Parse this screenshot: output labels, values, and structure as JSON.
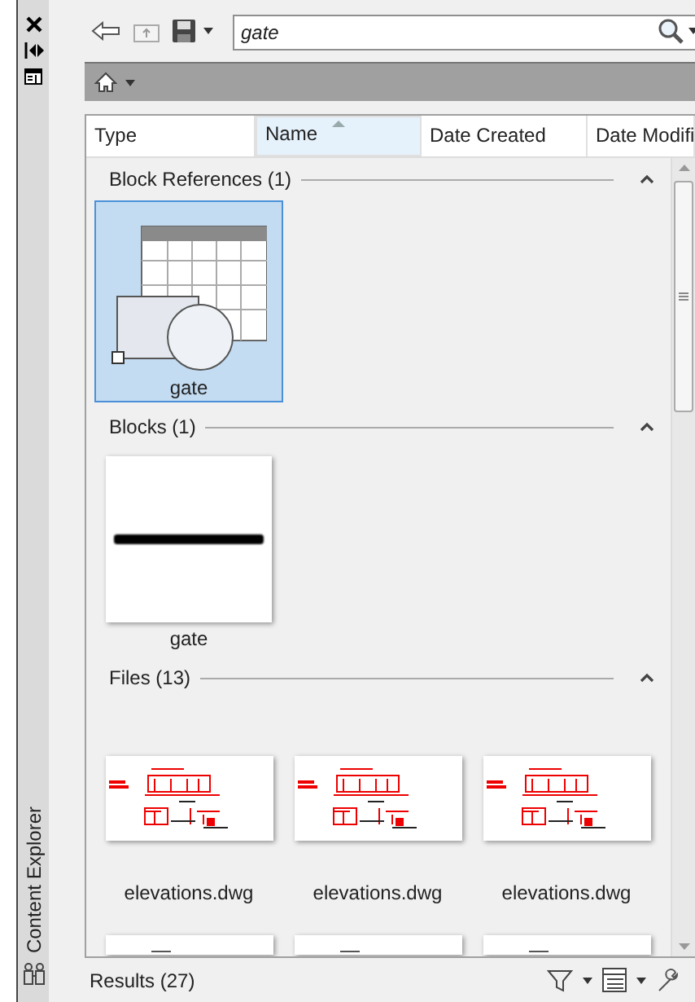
{
  "side_title": "Content Explorer",
  "search": {
    "value": "gate"
  },
  "columns": [
    {
      "label": "Type",
      "selected": false
    },
    {
      "label": "Name",
      "selected": true
    },
    {
      "label": "Date Created",
      "selected": false
    },
    {
      "label": "Date Modifi",
      "selected": false
    }
  ],
  "groups": [
    {
      "title": "Block References (1)",
      "expanded": true,
      "items": [
        {
          "kind": "block-reference",
          "name": "gate",
          "selected": true
        }
      ]
    },
    {
      "title": "Blocks (1)",
      "expanded": true,
      "items": [
        {
          "kind": "block",
          "name": "gate",
          "selected": false
        }
      ]
    },
    {
      "title": "Files (13)",
      "expanded": true,
      "items": [
        {
          "kind": "file",
          "name": "elevations.dwg",
          "selected": false
        },
        {
          "kind": "file",
          "name": "elevations.dwg",
          "selected": false
        },
        {
          "kind": "file",
          "name": "elevations.dwg",
          "selected": false
        },
        {
          "kind": "file-cut",
          "selected": false
        },
        {
          "kind": "file-cut",
          "selected": false
        },
        {
          "kind": "file-cut",
          "selected": false
        }
      ]
    }
  ],
  "status": "Results (27)"
}
